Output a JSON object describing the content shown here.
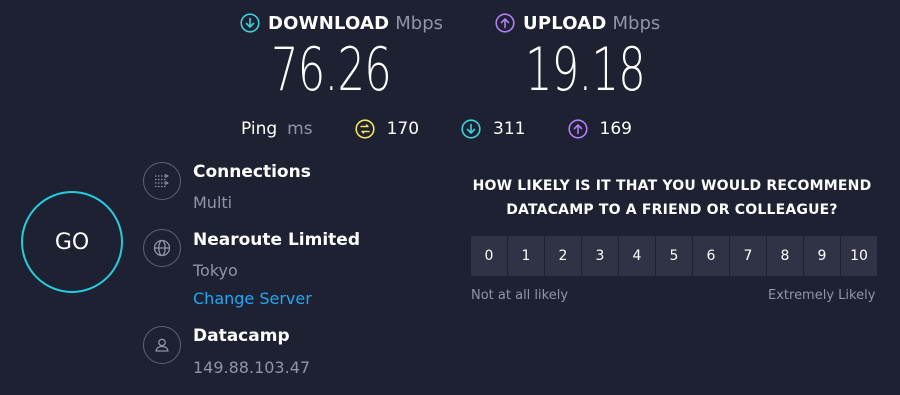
{
  "download": {
    "label": "DOWNLOAD",
    "unit": "Mbps",
    "value": "76.26",
    "icon": "download-icon",
    "color": "#38d3d9"
  },
  "upload": {
    "label": "UPLOAD",
    "unit": "Mbps",
    "value": "19.18",
    "icon": "upload-icon",
    "color": "#b27df6"
  },
  "ping": {
    "label": "Ping",
    "unit": "ms",
    "idle": {
      "value": "170",
      "icon": "ping-idle-icon",
      "color": "#f4e25b"
    },
    "download": {
      "value": "311",
      "icon": "ping-download-icon",
      "color": "#38d3d9"
    },
    "upload": {
      "value": "169",
      "icon": "ping-upload-icon",
      "color": "#b27df6"
    }
  },
  "go_button": {
    "label": "GO",
    "color": "#1fd0e0"
  },
  "connections": {
    "title": "Connections",
    "value": "Multi",
    "icon": "connections-icon"
  },
  "server": {
    "title": "Nearoute Limited",
    "location": "Tokyo",
    "change_label": "Change Server",
    "icon": "globe-icon"
  },
  "provider": {
    "title": "Datacamp",
    "ip": "149.88.103.47",
    "icon": "user-icon"
  },
  "survey": {
    "question": "HOW LIKELY IS IT THAT YOU WOULD RECOMMEND DATACAMP TO A FRIEND OR COLLEAGUE?",
    "options": [
      "0",
      "1",
      "2",
      "3",
      "4",
      "5",
      "6",
      "7",
      "8",
      "9",
      "10"
    ],
    "low_label": "Not at all likely",
    "high_label": "Extremely Likely"
  }
}
